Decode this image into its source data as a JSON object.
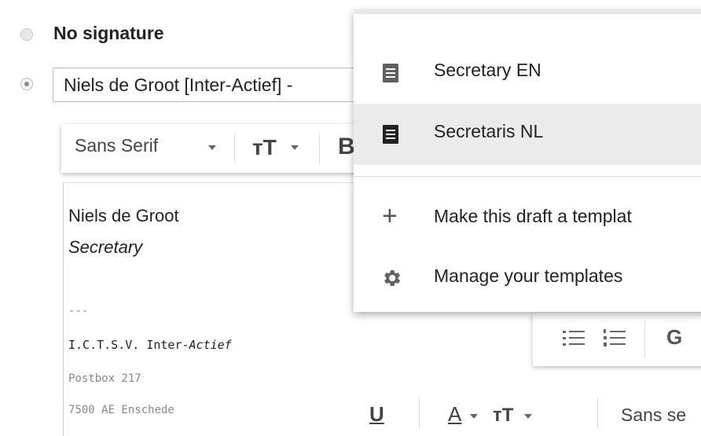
{
  "signature_settings": {
    "no_signature_label": "No signature",
    "selected_signature": "Niels de Groot [Inter-Actief] -"
  },
  "editor_toolbar": {
    "font_family": "Sans Serif",
    "font_family_2": "Sans se",
    "bold_label": "B",
    "underline_label": "U",
    "text_color_label": "A",
    "text_size_label": "тT"
  },
  "signature_body": {
    "name": "Niels de Groot",
    "role": "Secretary",
    "separator": "---",
    "org_prefix": "I.C.T.S.V. Inter-",
    "org_italic": "Actief",
    "address_line1": "Postbox 217",
    "address_line2": "7500 AE Enschede"
  },
  "templates_menu": {
    "items": [
      {
        "label": "Secretary EN",
        "icon": "document-icon"
      },
      {
        "label": "Secretaris NL",
        "icon": "document-icon"
      }
    ],
    "make_template_label": "Make this draft a templat",
    "manage_templates_label": "Manage your templates"
  },
  "colors": {
    "menu_highlight": "#ebebeb",
    "icon_gray": "#616161",
    "icon_dark": "#222222",
    "text_gray": "#888888"
  }
}
